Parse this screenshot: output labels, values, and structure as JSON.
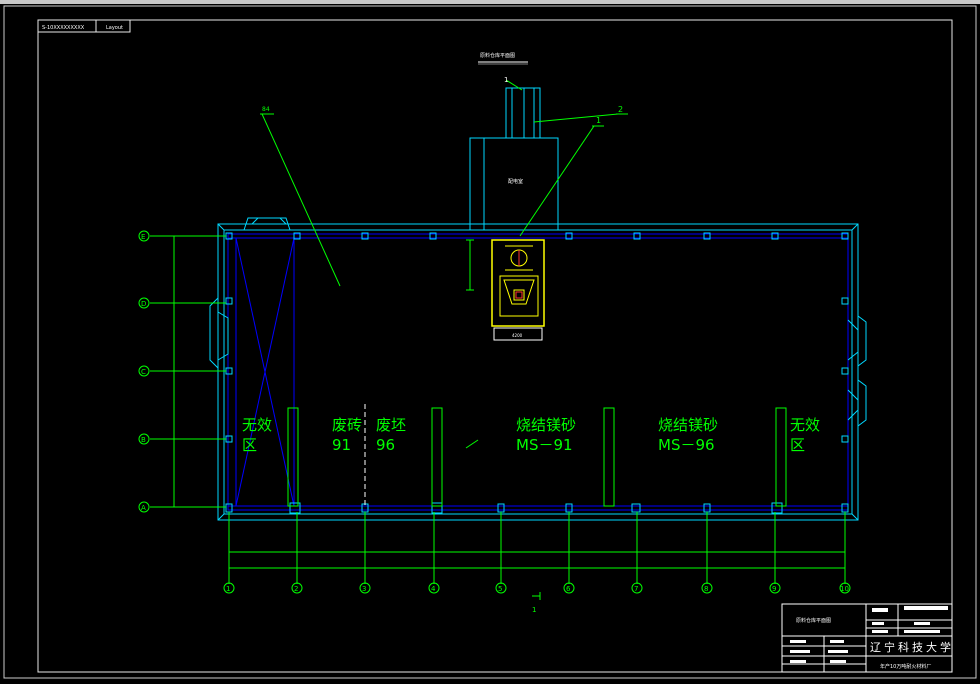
{
  "header": {
    "file_label": "S-10XXXXXXXXX",
    "tab_label": "Layout"
  },
  "drawing": {
    "title": "原料仓库平面图",
    "callouts": [
      "1",
      "2",
      "1",
      "84"
    ],
    "axis_rows": [
      "E",
      "D",
      "C",
      "B",
      "A"
    ],
    "axis_cols": [
      "1",
      "2",
      "3",
      "4",
      "5",
      "6",
      "7",
      "8",
      "9",
      "10"
    ],
    "zones": [
      {
        "l1": "无效",
        "l2": "区"
      },
      {
        "l1": "废砖",
        "l2": "91"
      },
      {
        "l1": "废坯",
        "l2": "96"
      },
      {
        "l1": "烧结镁砂",
        "l2": "MS－91"
      },
      {
        "l1": "烧结镁砂",
        "l2": "MS－96"
      },
      {
        "l1": "无效",
        "l2": "区"
      }
    ],
    "room_label": "配电室"
  },
  "title_block": {
    "drawing_name": "原料仓库平面图",
    "university": "辽宁科技大学",
    "project": "年产10万吨耐火材料厂",
    "bottom_callout": "1"
  },
  "colors": {
    "wall": "#00d8ff",
    "line": "#00ff00",
    "hatch": "#0000ff",
    "equipment": "#ffff00",
    "text": "#ffffff"
  }
}
